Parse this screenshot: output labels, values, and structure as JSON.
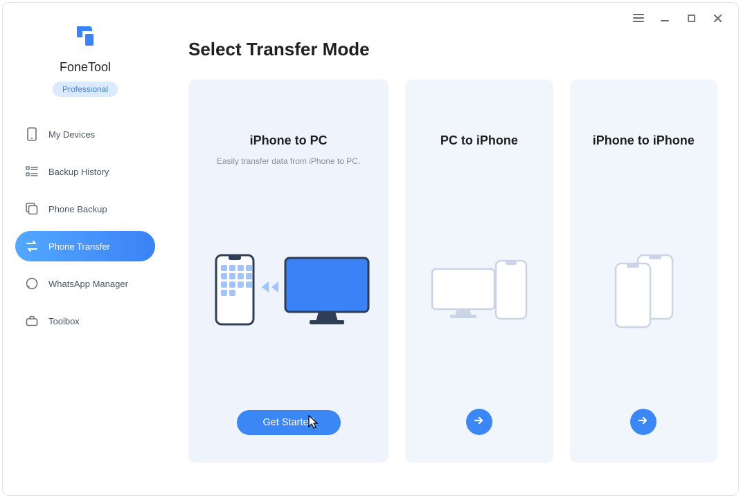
{
  "app": {
    "name": "FoneTool",
    "edition": "Professional"
  },
  "sidebar": {
    "items": [
      {
        "label": "My Devices"
      },
      {
        "label": "Backup History"
      },
      {
        "label": "Phone Backup"
      },
      {
        "label": "Phone Transfer"
      },
      {
        "label": "WhatsApp Manager"
      },
      {
        "label": "Toolbox"
      }
    ]
  },
  "main": {
    "title": "Select Transfer Mode",
    "cards": [
      {
        "title": "iPhone to PC",
        "subtitle": "Easily transfer data from iPhone to PC.",
        "cta": "Get Started"
      },
      {
        "title": "PC to iPhone"
      },
      {
        "title": "iPhone to iPhone"
      }
    ]
  }
}
